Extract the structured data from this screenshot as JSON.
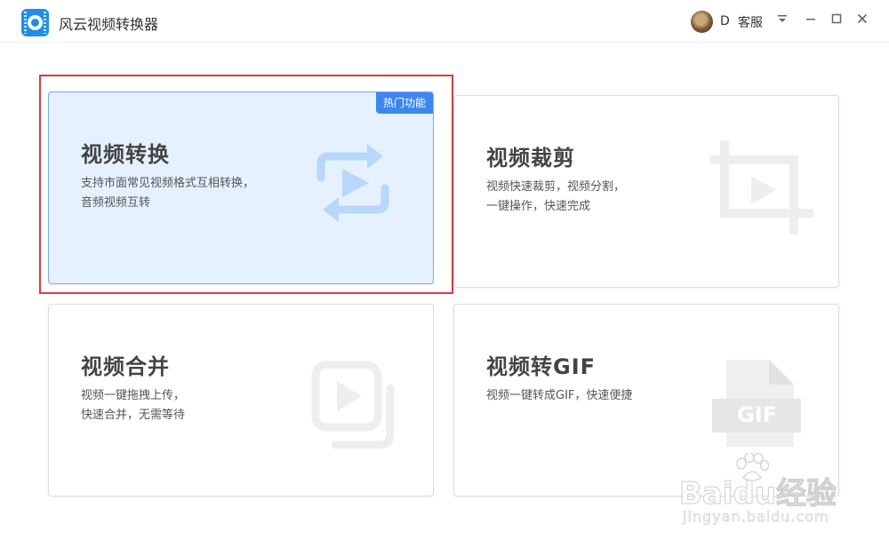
{
  "app": {
    "title": "风云视频转换器",
    "accent_color": "#1e8fe8"
  },
  "header": {
    "user_name": "D",
    "support_label": "客服",
    "menu_icon": "dropdown-menu-icon",
    "minimize_icon": "minimize-icon",
    "maximize_icon": "maximize-icon",
    "close_icon": "close-icon"
  },
  "cards": [
    {
      "title": "视频转换",
      "desc_line1": "支持市面常见视频格式互相转换，",
      "desc_line2": "音频视频互转",
      "badge": "热门功能",
      "icon": "convert-icon",
      "selected": true
    },
    {
      "title": "视频裁剪",
      "desc_line1": "视频快速裁剪，视频分割，",
      "desc_line2": "一键操作，快速完成",
      "icon": "crop-icon",
      "selected": false
    },
    {
      "title": "视频合并",
      "desc_line1": "视频一键拖拽上传，",
      "desc_line2": "快速合并，无需等待",
      "icon": "merge-icon",
      "selected": false
    },
    {
      "title": "视频转GIF",
      "desc_line1": "视频一键转成GIF，快速便捷",
      "desc_line2": "",
      "icon": "gif-file-icon",
      "icon_label": "GIF",
      "selected": false
    }
  ],
  "colors": {
    "selected_card_bg": "#e5f1ff",
    "badge_bg": "#3d87f0",
    "highlight_border": "#e0393a",
    "icon_blue": "#b9d6fb",
    "icon_gray": "#eeeeee"
  },
  "watermark": {
    "logo": "Baidu经验",
    "url": "jingyan.baidu.com"
  }
}
